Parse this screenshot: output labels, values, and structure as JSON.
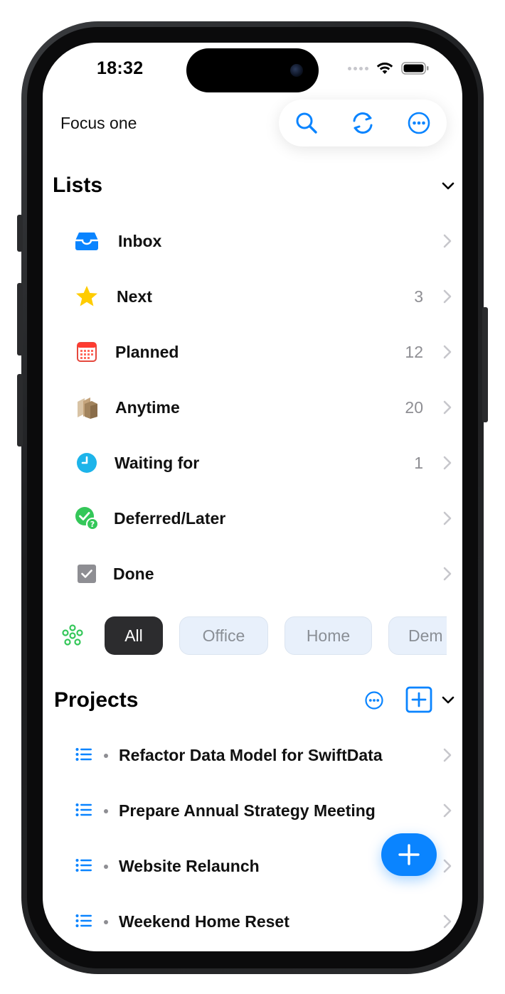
{
  "status": {
    "time": "18:32"
  },
  "header": {
    "title": "Focus one",
    "actions": [
      "search-icon",
      "sync-icon",
      "more-icon"
    ]
  },
  "lists": {
    "title": "Lists",
    "items": [
      {
        "label": "Inbox",
        "count": "",
        "icon": "inbox-tray-icon",
        "color": "#0a84ff"
      },
      {
        "label": "Next",
        "count": "3",
        "icon": "star-icon",
        "color": "#ffcc00"
      },
      {
        "label": "Planned",
        "count": "12",
        "icon": "calendar-icon",
        "color": "#ff3b30"
      },
      {
        "label": "Anytime",
        "count": "20",
        "icon": "boxes-icon",
        "color": "#a2845e"
      },
      {
        "label": "Waiting for",
        "count": "1",
        "icon": "clock-icon",
        "color": "#32ade6"
      },
      {
        "label": "Deferred/Later",
        "count": "",
        "icon": "deferred-check-icon",
        "color": "#34c759"
      },
      {
        "label": "Done",
        "count": "",
        "icon": "checkbox-icon",
        "color": "#8e8e93"
      }
    ]
  },
  "filters": {
    "icon": "context-filter-icon",
    "pills": [
      {
        "label": "All",
        "active": true
      },
      {
        "label": "Office",
        "active": false
      },
      {
        "label": "Home",
        "active": false
      },
      {
        "label": "Dem",
        "active": false
      }
    ]
  },
  "projects": {
    "title": "Projects",
    "items": [
      {
        "label": "Refactor Data Model for SwiftData"
      },
      {
        "label": "Prepare Annual Strategy Meeting"
      },
      {
        "label": "Website Relaunch"
      },
      {
        "label": "Weekend Home Reset"
      }
    ]
  },
  "colors": {
    "accent": "#0a84ff",
    "pill_active": "#2c2c2e",
    "pill_inactive": "#e8f0fb"
  }
}
